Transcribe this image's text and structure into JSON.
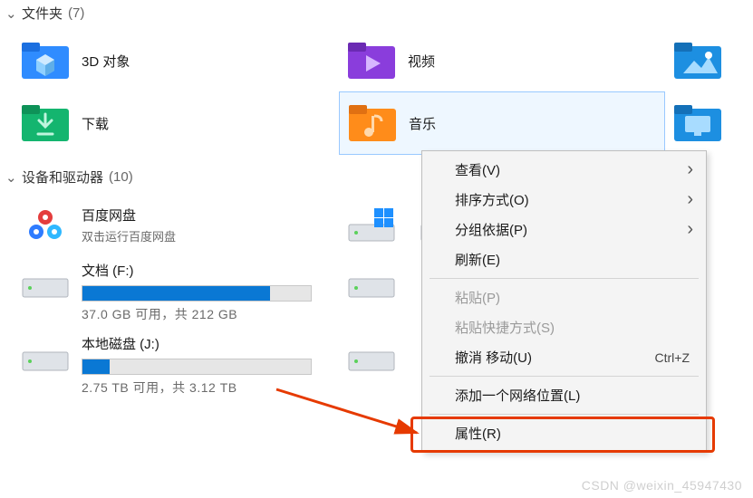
{
  "sections": {
    "folders": {
      "title": "文件夹",
      "count": "(7)"
    },
    "drives": {
      "title": "设备和驱动器",
      "count": "(10)"
    }
  },
  "folders": [
    {
      "label": "3D 对象"
    },
    {
      "label": "视频"
    },
    {
      "label": ""
    },
    {
      "label": "下载"
    },
    {
      "label": "音乐"
    },
    {
      "label": ""
    }
  ],
  "baidu": {
    "label": "百度网盘",
    "sub": "双击运行百度网盘"
  },
  "drive_partial": {
    "label": ""
  },
  "drives": [
    {
      "label": "文档 (F:)",
      "usage": "37.0 GB 可用，共 212 GB",
      "fill": "82%"
    },
    {
      "label": "本地磁盘 (J:)",
      "usage": "2.75 TB 可用，共 3.12 TB",
      "fill": "12%"
    }
  ],
  "menu": {
    "view": "查看(V)",
    "sort": "排序方式(O)",
    "group": "分组依据(P)",
    "refresh": "刷新(E)",
    "paste": "粘贴(P)",
    "paste_shortcut": "粘贴快捷方式(S)",
    "undo": "撤消 移动(U)",
    "undo_key": "Ctrl+Z",
    "add_network": "添加一个网络位置(L)",
    "properties": "属性(R)"
  },
  "watermark": "CSDN @weixin_45947430"
}
